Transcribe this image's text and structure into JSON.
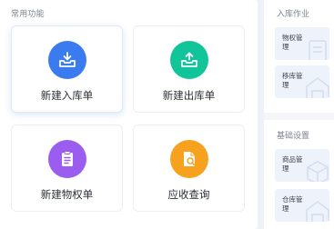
{
  "common": {
    "section_title": "常用功能",
    "cards": [
      {
        "label": "新建入库单",
        "icon": "inbox-download-icon",
        "color": "#3a7bf0"
      },
      {
        "label": "新建出库单",
        "icon": "inbox-upload-icon",
        "color": "#12c49a"
      },
      {
        "label": "新建物权单",
        "icon": "document-list-icon",
        "color": "#9b5cf0"
      },
      {
        "label": "应收查询",
        "icon": "document-search-icon",
        "color": "#f6a21e"
      }
    ]
  },
  "warehouse_ops": {
    "section_title": "入库作业",
    "items": [
      {
        "label": "物权管理"
      },
      {
        "label": "移库管理"
      }
    ]
  },
  "basic_settings": {
    "section_title": "基础设置",
    "items": [
      {
        "label": "商品管理"
      },
      {
        "label": "仓库管理"
      }
    ]
  }
}
